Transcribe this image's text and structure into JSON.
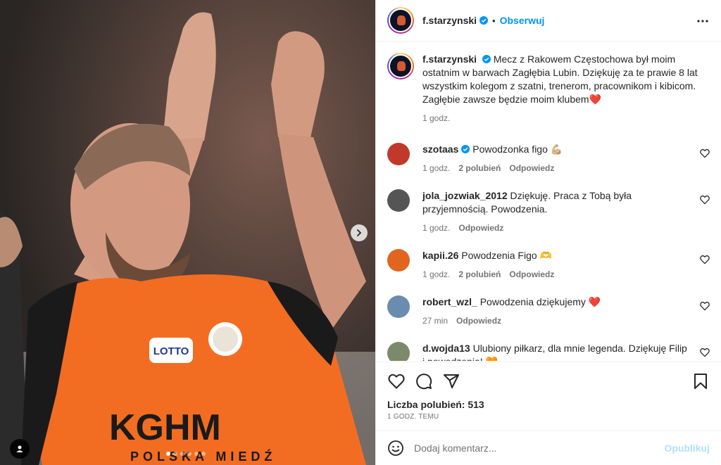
{
  "header": {
    "username": "f.starzynski",
    "bullet": "•",
    "follow_label": "Obserwuj",
    "more_icon": "more-horizontal-icon",
    "verified_icon": "verified-badge-icon"
  },
  "caption": {
    "username": "f.starzynski",
    "text": "Mecz z Rakowem Częstochowa był moim ostatnim w barwach Zagłębia Lubin. Dziękuję za te prawie 8 lat wszystkim kolegom z szatni, trenerom, pracownikom i kibicom. Zagłębie zawsze będzie moim klubem❤️",
    "time": "1 godz."
  },
  "comments": [
    {
      "username": "szotaas",
      "verified": true,
      "text": "Powodzonka figo 💪🏼",
      "time": "1 godz.",
      "likes": "2 polubień",
      "reply": "Odpowiedz",
      "avatar_color": "#c0392b"
    },
    {
      "username": "jola_jozwiak_2012",
      "verified": false,
      "text": "Dziękuję. Praca z Tobą była przyjemnością. Powodzenia.",
      "time": "1 godz.",
      "likes": "",
      "reply": "Odpowiedz",
      "avatar_color": "#555555"
    },
    {
      "username": "kapii.26",
      "verified": false,
      "text": "Powodzenia Figo 🫶",
      "time": "1 godz.",
      "likes": "2 polubień",
      "reply": "Odpowiedz",
      "avatar_color": "#e0651f"
    },
    {
      "username": "robert_wzl_",
      "verified": false,
      "text": "Powodzenia dziękujemy ❤️",
      "time": "27 min",
      "likes": "",
      "reply": "Odpowiedz",
      "avatar_color": "#6a8caf"
    },
    {
      "username": "d.wojda13",
      "verified": false,
      "text": "Ulubiony piłkarz, dla mnie legenda. Dziękuję Filip i powodzenia! 🧡",
      "time": "",
      "likes": "",
      "reply": "",
      "avatar_color": "#7a8a6a"
    }
  ],
  "actions": {
    "like_icon": "heart-icon",
    "comment_icon": "comment-icon",
    "share_icon": "share-icon",
    "save_icon": "bookmark-icon",
    "likes_label": "Liczba polubień: 513",
    "timestamp": "1 GODZ. TEMU"
  },
  "add_comment": {
    "placeholder": "Dodaj komentarz...",
    "publish_label": "Opublikuj",
    "emoji_icon": "emoji-icon"
  },
  "media": {
    "carousel": {
      "total_slides": 6,
      "active_slide": 1
    },
    "next_icon": "chevron-right-icon",
    "tag_icon": "user-tag-icon",
    "shirt_text_1": "KGHM",
    "shirt_text_2": "POLSKA MIEDŹ",
    "sponsor_text": "LOTTO"
  },
  "colors": {
    "accent": "#0095f6",
    "publish_disabled": "#b2dffc",
    "text": "#262626",
    "muted": "#737373",
    "jersey": "#f26d21"
  }
}
